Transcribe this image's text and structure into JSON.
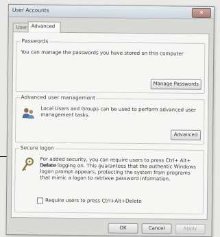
{
  "window": {
    "title": "User Accounts",
    "close_label": "✕"
  },
  "tabs": [
    {
      "label": "Users",
      "selected": false
    },
    {
      "label": "Advanced",
      "selected": true
    }
  ],
  "passwords": {
    "heading": "Passwords",
    "description": "You can manage the passwords you have stored on this computer",
    "button": "Manage Passwords"
  },
  "advanced_user_management": {
    "heading": "Advanced user management",
    "description_line1": "Local Users and Groups can be used to perform advanced user",
    "description_line2": "management tasks.",
    "button": "Advanced",
    "icon": "users-icon"
  },
  "secure_logon": {
    "heading": "Secure logon",
    "lines": [
      "For added security, you can require users to press Ctrl+ Alt+ Delete",
      "before logging on. This guarantees that the authentic Windows",
      "logon prompt appears, protecting the system from programs",
      "that mimic a logon to retrieve password information."
    ],
    "checkbox_label": "Require users to press Ctrl+Alt+Delete",
    "checked": false,
    "icon": "key-icon"
  },
  "footer": {
    "ok": "OK",
    "cancel": "Cancel",
    "apply": "Apply"
  }
}
